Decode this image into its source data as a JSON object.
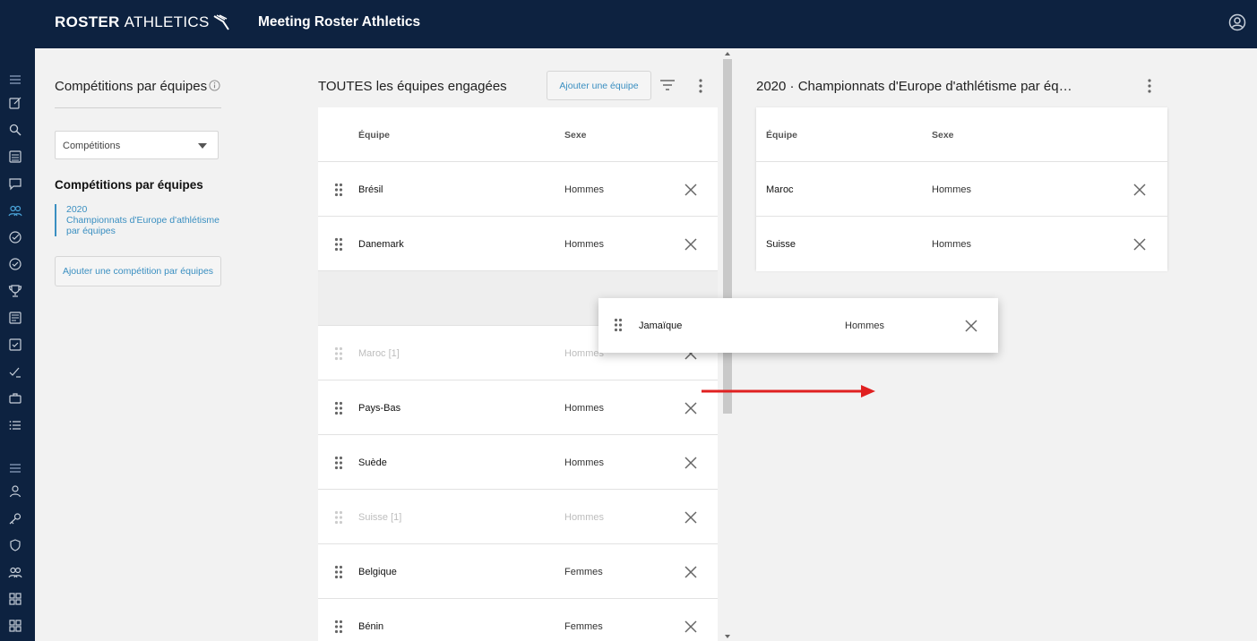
{
  "header": {
    "brand_bold": "ROSTER",
    "brand_light": "ATHLETICS",
    "app_title": "Meeting Roster Athletics"
  },
  "rail": {
    "icons": [
      "menu-icon",
      "edit-icon",
      "search-icon",
      "list-icon",
      "message-icon",
      "teams-icon",
      "check-circle-icon",
      "check-circle-icon",
      "trophy-icon",
      "document-icon",
      "checkbox-icon",
      "check-edit-icon",
      "briefcase-icon",
      "list-bullets-icon",
      "menu-icon",
      "person-icon",
      "key-icon",
      "shield-icon",
      "people-icon",
      "grid-icon",
      "grid-icon"
    ]
  },
  "left_panel": {
    "title": "Compétitions par équipes",
    "select_value": "Compétitions",
    "section_title": "Compétitions par équipes",
    "item_year": "2020",
    "item_line1": "Championnats d'Europe d'athlétisme",
    "item_line2": "par équipes",
    "add_button": "Ajouter une compétition par équipes"
  },
  "middle_panel": {
    "title": "TOUTES les équipes engagées",
    "add_button": "Ajouter une équipe",
    "col_team": "Équipe",
    "col_sex": "Sexe",
    "rows": [
      {
        "team": "Brésil",
        "sex": "Hommes"
      },
      {
        "team": "Danemark",
        "sex": "Hommes"
      },
      {
        "team": "",
        "sex": ""
      },
      {
        "team": "Maroc [1]",
        "sex": "Hommes"
      },
      {
        "team": "Pays-Bas",
        "sex": "Hommes"
      },
      {
        "team": "Suède",
        "sex": "Hommes"
      },
      {
        "team": "Suisse [1]",
        "sex": "Hommes"
      },
      {
        "team": "Belgique",
        "sex": "Femmes"
      },
      {
        "team": "Bénin",
        "sex": "Femmes"
      }
    ]
  },
  "right_panel": {
    "title": "2020 · Championnats d'Europe d'athlétisme par éq…",
    "col_team": "Équipe",
    "col_sex": "Sexe",
    "rows": [
      {
        "team": "Maroc",
        "sex": "Hommes"
      },
      {
        "team": "Suisse",
        "sex": "Hommes"
      }
    ]
  },
  "drag_ghost": {
    "team": "Jamaïque",
    "sex": "Hommes"
  },
  "colors": {
    "navy": "#0d2240",
    "accent": "#3a8fc1",
    "arrow": "#e02020"
  }
}
